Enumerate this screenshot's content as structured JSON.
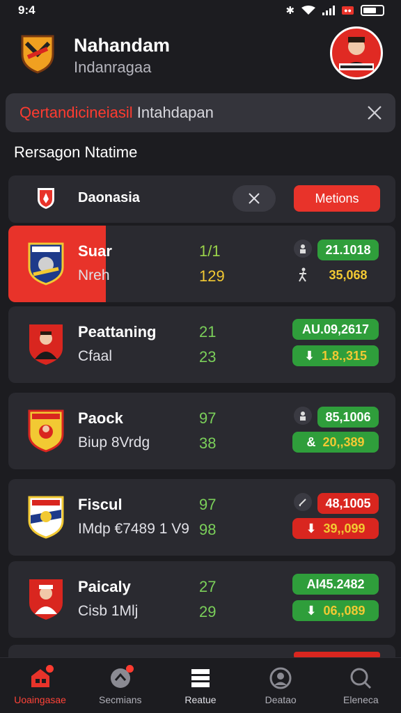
{
  "status_bar": {
    "time": "9:4"
  },
  "header": {
    "title": "Nahandam",
    "subtitle": "Indanragaa"
  },
  "search": {
    "highlight": "Qertandicineiasil",
    "rest": " Intahdapan"
  },
  "section_title": "Rersagon Ntatime",
  "filter": {
    "label": "Daonasia",
    "button": "Metions"
  },
  "cards": [
    {
      "name": "Suar",
      "sub": "Nreh",
      "n1": "1/1",
      "n2": "129",
      "pill1": "21.1018",
      "pill2": "35,068",
      "style": "first"
    },
    {
      "name": "Peattaning",
      "sub": "Cfaal",
      "n1": "21",
      "n2": "23",
      "pill1": "AU.09,2617",
      "pill2": "1.8.,315",
      "style": "green"
    },
    {
      "name": "Paock",
      "sub": "Biup 8Vrdg",
      "n1": "97",
      "n2": "38",
      "pill1": "85,1006",
      "pill2": "20,,389",
      "style": "green"
    },
    {
      "name": "Fiscul",
      "sub": "IMdp €7489 1 V9",
      "n1": "97",
      "n2": "98",
      "pill1": "48,1005",
      "pill2": "39,,099",
      "style": "red"
    },
    {
      "name": "Paicaly",
      "sub": "Cisb 1Mlj",
      "n1": "27",
      "n2": "29",
      "pill1": "AI45.2482",
      "pill2": "06,,089",
      "style": "green"
    }
  ],
  "nav": [
    {
      "label": "Uoaingasae",
      "icon": "home-icon"
    },
    {
      "label": "Secmians",
      "icon": "ball-icon"
    },
    {
      "label": "Reatue",
      "icon": "list-icon"
    },
    {
      "label": "Deatao",
      "icon": "user-icon"
    },
    {
      "label": "Eleneca",
      "icon": "search-icon"
    }
  ],
  "colors": {
    "accent": "#e8332a",
    "green": "#2f9e3b",
    "yellow": "#f2c933",
    "bg": "#1c1c20",
    "card": "#2a2a30"
  }
}
